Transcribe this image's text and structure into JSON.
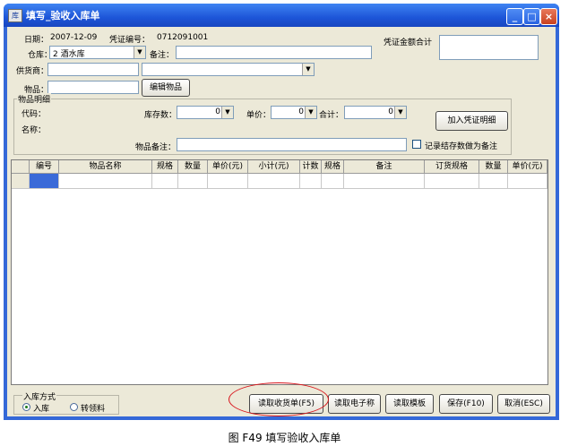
{
  "window": {
    "title": "填写_验收入库单",
    "app_icon_glyph": "库",
    "buttons": {
      "minimize": "_",
      "maximize": "□",
      "close": "×"
    }
  },
  "header": {
    "date_label": "日期：",
    "date_value": "2007-12-09",
    "voucher_no_label": "凭证编号：",
    "voucher_no_value": "0712091001",
    "voucher_total_label": "凭证金额合计",
    "voucher_total_value": "",
    "warehouse_label": "仓库：",
    "warehouse_value": "2 酒水库",
    "remark_label": "备注：",
    "remark_value": "",
    "supplier_label": "供货商：",
    "supplier_code_value": "",
    "supplier_name_value": "",
    "item_label": "物品：",
    "item_value": "",
    "edit_item_button": "编辑物品"
  },
  "item_detail": {
    "group_title": "物品明细",
    "code_label": "代码：",
    "name_label": "名称：",
    "stock_label": "库存数：",
    "stock_value": "0",
    "price_label": "单价：",
    "price_value": "0",
    "total_label": "合计：",
    "total_value": "0",
    "add_button": "加入凭证明细",
    "item_remark_label": "物品备注：",
    "item_remark_value": "",
    "checkbox_label": "记录结存数做为备注",
    "checkbox_checked": false
  },
  "grid": {
    "columns": [
      "编号",
      "物品名称",
      "规格",
      "数量",
      "单价(元)",
      "小计(元)",
      "计数",
      "规格",
      "备注",
      "订货规格",
      "数量",
      "单价(元)"
    ]
  },
  "footer": {
    "group_title": "入库方式",
    "radio_inbound": "入库",
    "radio_transfer": "转领料",
    "inbound_selected": true,
    "btn_read_receipt": "读取收货单(F5)",
    "btn_read_scale": "读取电子称",
    "btn_read_template": "读取模板",
    "btn_save": "保存(F10)",
    "btn_cancel": "取消(ESC)"
  },
  "caption": "图 F49  填写验收入库单",
  "colors": {
    "title_bar": "#1d55d8",
    "client_bg": "#ece9d8",
    "annotation": "#d8141b",
    "grid_selected_cell": "#3a6ad8"
  }
}
